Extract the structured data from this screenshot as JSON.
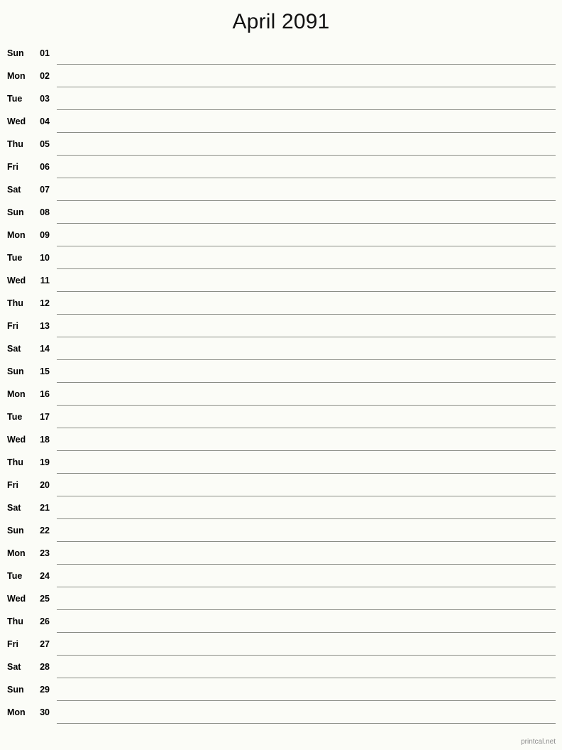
{
  "document": {
    "title": "April 2091",
    "month": "April",
    "year": "2091",
    "type": "printable-monthly-calendar-single-column-notes"
  },
  "theme": {
    "background": "#fbfcf7",
    "text": "#000000",
    "line": "#8a8d86",
    "footer_text": "#8c8c8c"
  },
  "rows": [
    {
      "weekday": "Sun",
      "date": "01"
    },
    {
      "weekday": "Mon",
      "date": "02"
    },
    {
      "weekday": "Tue",
      "date": "03"
    },
    {
      "weekday": "Wed",
      "date": "04"
    },
    {
      "weekday": "Thu",
      "date": "05"
    },
    {
      "weekday": "Fri",
      "date": "06"
    },
    {
      "weekday": "Sat",
      "date": "07"
    },
    {
      "weekday": "Sun",
      "date": "08"
    },
    {
      "weekday": "Mon",
      "date": "09"
    },
    {
      "weekday": "Tue",
      "date": "10"
    },
    {
      "weekday": "Wed",
      "date": "11"
    },
    {
      "weekday": "Thu",
      "date": "12"
    },
    {
      "weekday": "Fri",
      "date": "13"
    },
    {
      "weekday": "Sat",
      "date": "14"
    },
    {
      "weekday": "Sun",
      "date": "15"
    },
    {
      "weekday": "Mon",
      "date": "16"
    },
    {
      "weekday": "Tue",
      "date": "17"
    },
    {
      "weekday": "Wed",
      "date": "18"
    },
    {
      "weekday": "Thu",
      "date": "19"
    },
    {
      "weekday": "Fri",
      "date": "20"
    },
    {
      "weekday": "Sat",
      "date": "21"
    },
    {
      "weekday": "Sun",
      "date": "22"
    },
    {
      "weekday": "Mon",
      "date": "23"
    },
    {
      "weekday": "Tue",
      "date": "24"
    },
    {
      "weekday": "Wed",
      "date": "25"
    },
    {
      "weekday": "Thu",
      "date": "26"
    },
    {
      "weekday": "Fri",
      "date": "27"
    },
    {
      "weekday": "Sat",
      "date": "28"
    },
    {
      "weekday": "Sun",
      "date": "29"
    },
    {
      "weekday": "Mon",
      "date": "30"
    }
  ],
  "footer": {
    "label": "printcal.net"
  }
}
